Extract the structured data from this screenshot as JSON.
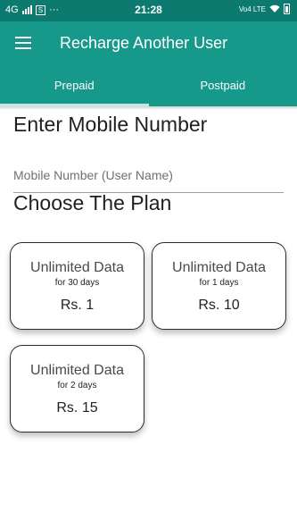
{
  "status_bar": {
    "network": "4G",
    "sim_badge": "S",
    "more": "···",
    "time": "21:28",
    "volte": "Vo4 LTE"
  },
  "app_bar": {
    "title": "Recharge Another User",
    "menu_icon": "hamburger-menu-icon"
  },
  "tabs": [
    {
      "label": "Prepaid",
      "active": true
    },
    {
      "label": "Postpaid",
      "active": false
    }
  ],
  "mobile_section": {
    "heading": "Enter Mobile Number",
    "input_placeholder": "Mobile Number (User Name)",
    "input_value": ""
  },
  "plan_section": {
    "heading": "Choose The Plan",
    "plans": [
      {
        "title": "Unlimited Data",
        "duration": "for 30 days",
        "price": "Rs. 1"
      },
      {
        "title": "Unlimited Data",
        "duration": "for 1 days",
        "price": "Rs. 10"
      },
      {
        "title": "Unlimited Data",
        "duration": "for 2 days",
        "price": "Rs. 15"
      }
    ]
  },
  "colors": {
    "status_bar": "#0c7a6e",
    "app_bar": "#16998a",
    "tab_indicator": "#bfe9e3"
  }
}
